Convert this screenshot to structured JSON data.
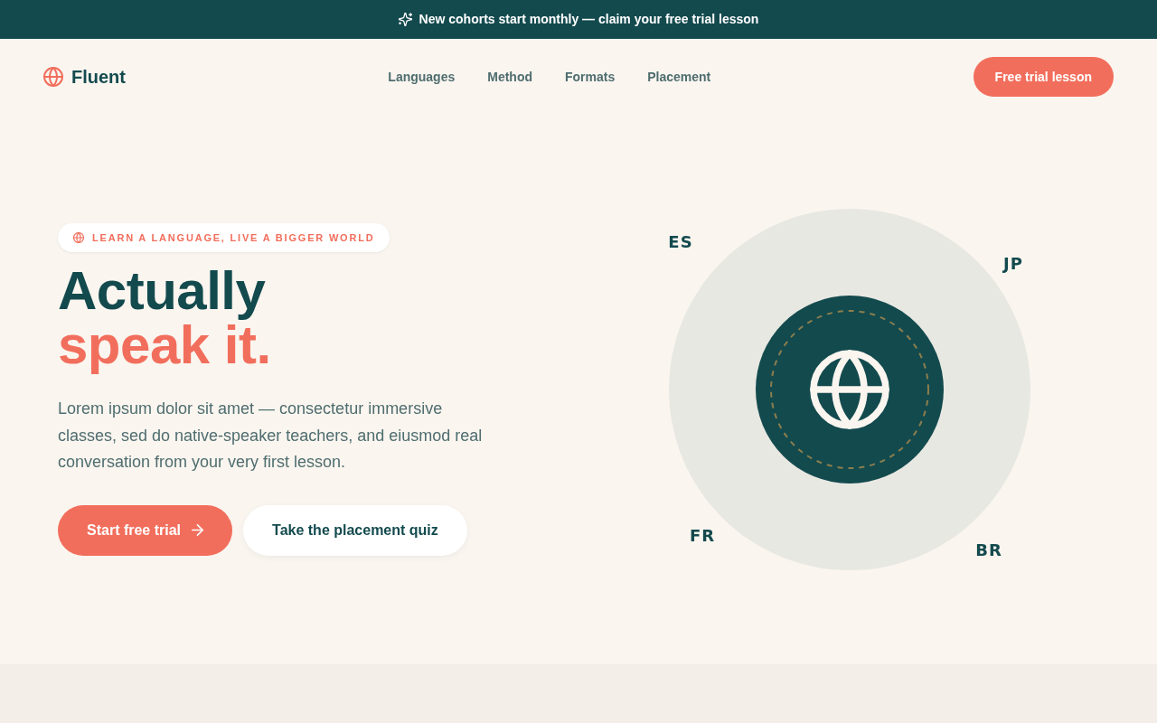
{
  "announcement": "New cohorts start monthly — claim your free trial lesson",
  "navbar": {
    "brand": "Fluent",
    "links": [
      "Languages",
      "Method",
      "Formats",
      "Placement"
    ],
    "cta_button": "Free trial lesson"
  },
  "hero": {
    "eyebrow": "LEARN A LANGUAGE, LIVE A BIGGER WORLD",
    "title_lines": [
      "Actually",
      "speak it."
    ],
    "description": "Lorem ipsum dolor sit amet — consectetur immersive classes, sed do native-speaker teachers, and eiusmod real conversation from your very first lesson.",
    "buttons": [
      {
        "label": "Start free trial",
        "kind": "primary"
      },
      {
        "label": "Take the placement quiz",
        "kind": "secondary"
      }
    ],
    "orbit_labels": [
      "ES",
      "JP",
      "FR",
      "BR"
    ]
  }
}
